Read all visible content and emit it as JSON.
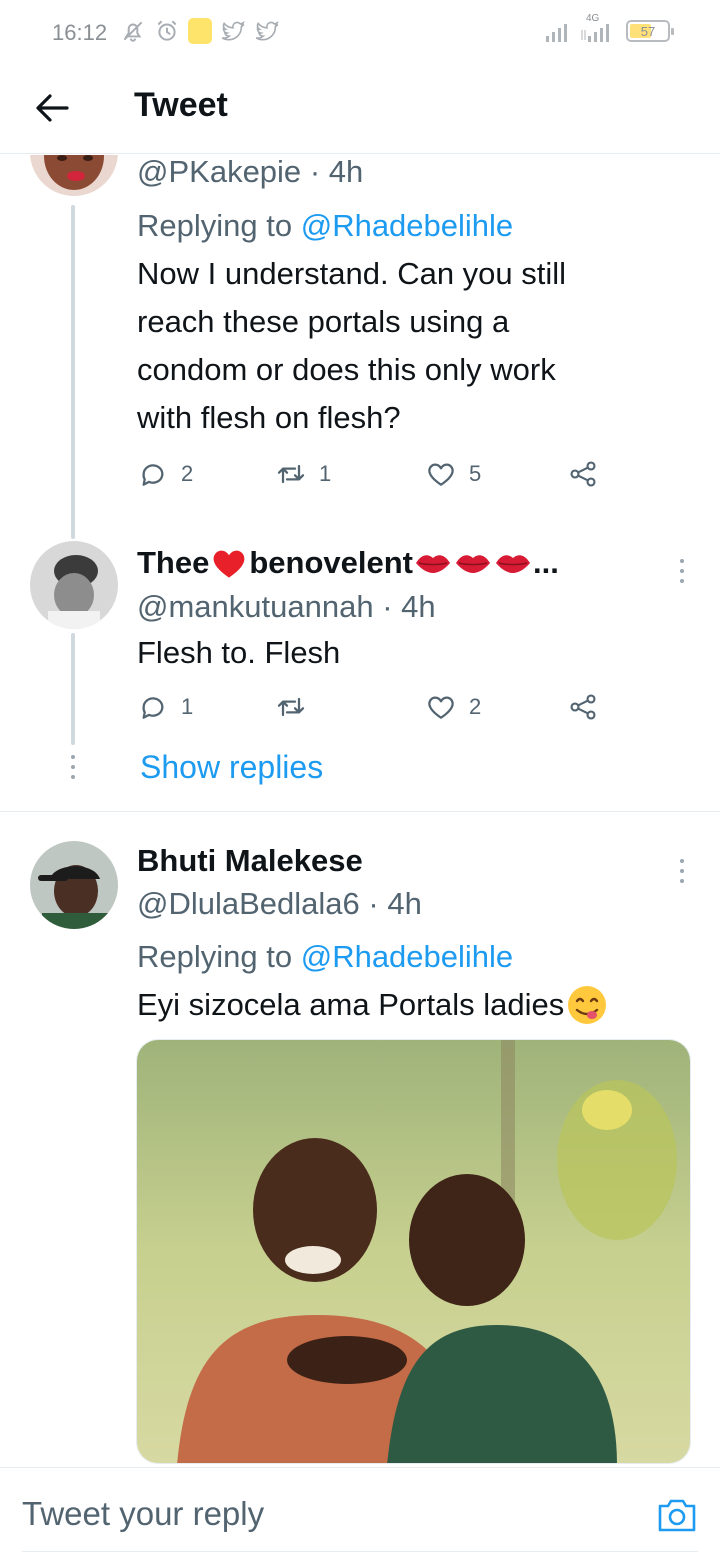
{
  "status_bar": {
    "time": "16:12",
    "network": "4G",
    "battery": "57",
    "battery_level": 0.57,
    "icons": [
      "notifications-off-icon",
      "alarm-icon",
      "app-notification-icon",
      "twitter-icon",
      "twitter-icon",
      "signal-icon",
      "signal-4g-icon",
      "battery-icon"
    ]
  },
  "header": {
    "back_icon": "arrow-left-icon",
    "title": "Tweet"
  },
  "tweets": [
    {
      "handle": "@PKakepie",
      "sep": "·",
      "time": "4h",
      "replying_prefix": "Replying to ",
      "replying_to": "@Rhadebelihle",
      "text_lines": [
        "Now I  understand. Can you still",
        "reach these portals using a",
        "condom or does this only work",
        "with flesh on flesh?"
      ],
      "replies": "2",
      "retweets": "1",
      "likes": "5"
    },
    {
      "name_a": "Thee",
      "name_b": "benovelent",
      "name_ellipsis": "...",
      "handle": "@mankutuannah",
      "sep": "·",
      "time": "4h",
      "text": "Flesh to. Flesh",
      "replies": "1",
      "retweets": "",
      "likes": "2",
      "show_replies": "Show replies"
    },
    {
      "name": "Bhuti Malekese",
      "handle": "@DlulaBedlala6",
      "sep": "·",
      "time": "4h",
      "replying_prefix": "Replying to ",
      "replying_to": "@Rhadebelihle",
      "text": "Eyi sizocela ama Portals ladies"
    }
  ],
  "reply_bar": {
    "placeholder": "Tweet your reply",
    "camera_icon": "camera-icon"
  },
  "colors": {
    "accent": "#1d9bf0",
    "text": "#0f1419",
    "muted": "#536471",
    "thread_line": "#cfd9de",
    "heart": "#e8202a",
    "lips": "#d81b35"
  }
}
